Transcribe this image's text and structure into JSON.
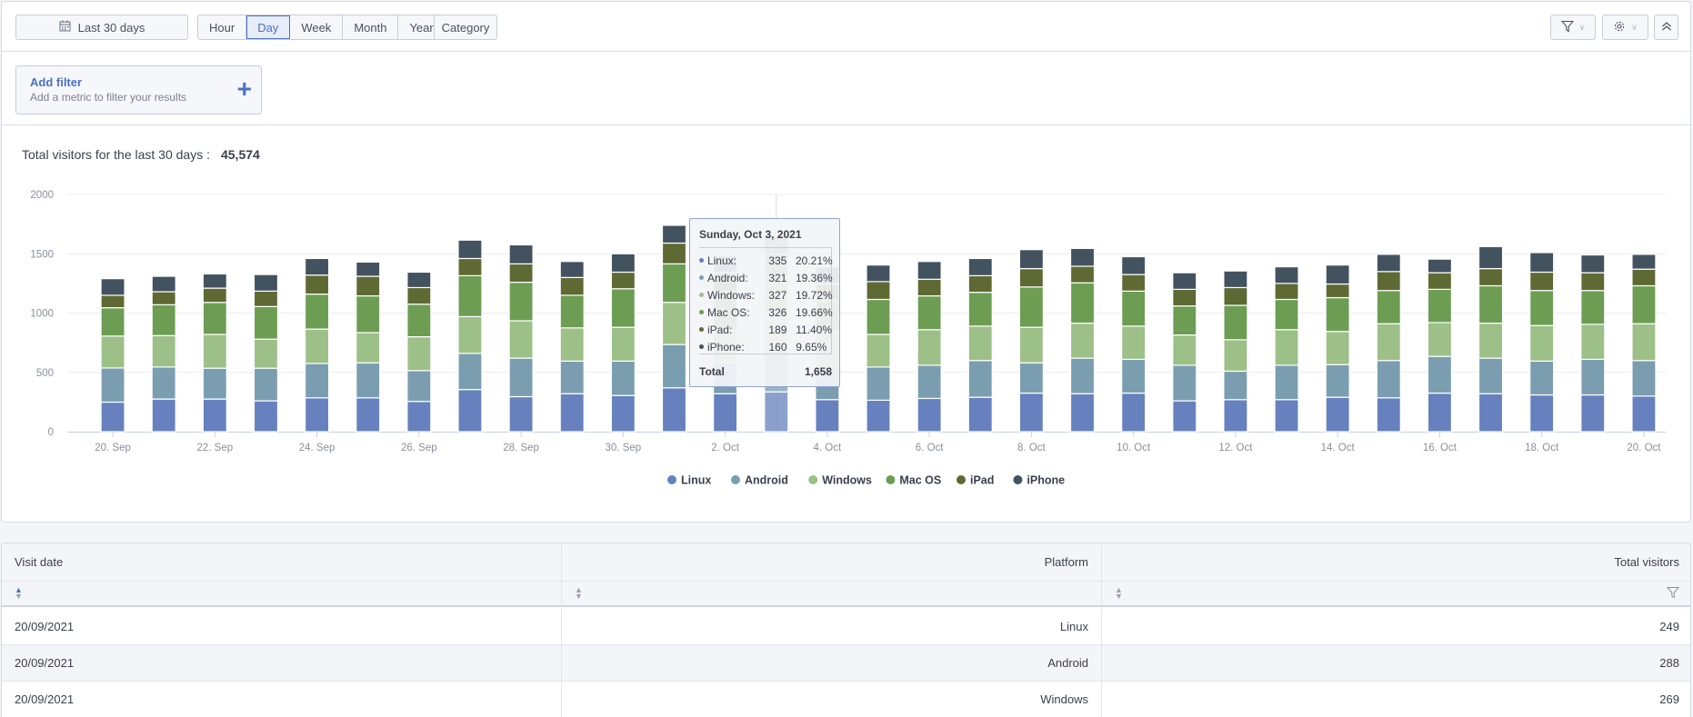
{
  "toolbar": {
    "date_range": "Last 30 days",
    "granularity": [
      "Hour",
      "Day",
      "Week",
      "Month",
      "Year"
    ],
    "granularity_selected": "Day",
    "category_label": "Category"
  },
  "filter": {
    "title": "Add filter",
    "subtitle": "Add a metric to filter your results",
    "plus": "+"
  },
  "summary": {
    "label": "Total visitors for the last 30 days :",
    "value": "45,574"
  },
  "chart_data": {
    "type": "bar",
    "stacked": true,
    "title": "",
    "xlabel": "",
    "ylabel": "",
    "ylim": [
      0,
      2000
    ],
    "yticks": [
      0,
      500,
      1000,
      1500,
      2000
    ],
    "grid": true,
    "legend_position": "bottom-center",
    "categories": [
      "20 Sep",
      "21 Sep",
      "22 Sep",
      "23 Sep",
      "24 Sep",
      "25 Sep",
      "26 Sep",
      "27 Sep",
      "28 Sep",
      "29 Sep",
      "30 Sep",
      "1 Oct",
      "2 Oct",
      "3 Oct",
      "4 Oct",
      "5 Oct",
      "6 Oct",
      "7 Oct",
      "8 Oct",
      "9 Oct",
      "10 Oct",
      "11 Oct",
      "12 Oct",
      "13 Oct",
      "14 Oct",
      "15 Oct",
      "16 Oct",
      "17 Oct",
      "18 Oct",
      "19 Oct",
      "20 Oct"
    ],
    "xtick_labels": [
      "20. Sep",
      "22. Sep",
      "24. Sep",
      "26. Sep",
      "28. Sep",
      "30. Sep",
      "2. Oct",
      "4. Oct",
      "6. Oct",
      "8. Oct",
      "10. Oct",
      "12. Oct",
      "14. Oct",
      "16. Oct",
      "18. Oct",
      "20. Oct"
    ],
    "series": [
      {
        "name": "Linux",
        "color": "#6681bd",
        "values": [
          249,
          275,
          275,
          260,
          285,
          285,
          255,
          355,
          295,
          320,
          305,
          370,
          320,
          335,
          270,
          265,
          280,
          290,
          325,
          320,
          325,
          260,
          270,
          270,
          290,
          285,
          325,
          320,
          310,
          310,
          300
        ]
      },
      {
        "name": "Android",
        "color": "#7a9eb0",
        "values": [
          288,
          270,
          260,
          275,
          290,
          295,
          260,
          305,
          325,
          275,
          290,
          365,
          265,
          321,
          270,
          280,
          280,
          310,
          255,
          300,
          285,
          300,
          240,
          290,
          275,
          315,
          310,
          300,
          285,
          300,
          300
        ]
      },
      {
        "name": "Windows",
        "color": "#9dbf88",
        "values": [
          269,
          265,
          285,
          245,
          290,
          255,
          285,
          310,
          315,
          280,
          285,
          355,
          270,
          327,
          300,
          275,
          300,
          290,
          300,
          295,
          280,
          255,
          265,
          300,
          280,
          310,
          285,
          295,
          300,
          295,
          310
        ]
      },
      {
        "name": "Mac OS",
        "color": "#6c9d53",
        "values": [
          239,
          260,
          270,
          275,
          295,
          310,
          275,
          345,
          325,
          275,
          325,
          325,
          325,
          326,
          265,
          295,
          285,
          285,
          340,
          340,
          295,
          245,
          290,
          255,
          285,
          280,
          280,
          315,
          295,
          285,
          320
        ]
      },
      {
        "name": "iPad",
        "color": "#5e6934",
        "values": [
          105,
          110,
          120,
          130,
          160,
          165,
          140,
          145,
          155,
          150,
          140,
          175,
          160,
          189,
          140,
          150,
          140,
          140,
          155,
          140,
          140,
          140,
          150,
          135,
          115,
          160,
          140,
          145,
          155,
          150,
          140
        ]
      },
      {
        "name": "iPhone",
        "color": "#43525f",
        "values": [
          140,
          130,
          120,
          140,
          140,
          120,
          130,
          155,
          160,
          135,
          155,
          150,
          140,
          160,
          145,
          140,
          150,
          145,
          160,
          150,
          150,
          140,
          140,
          140,
          160,
          145,
          115,
          185,
          165,
          150,
          125
        ]
      }
    ],
    "highlighted_category": "3 Oct"
  },
  "tooltip": {
    "title": "Sunday, Oct 3, 2021",
    "rows": [
      {
        "label": "Linux:",
        "value": "335",
        "pct": "20.21%",
        "color": "#6681bd"
      },
      {
        "label": "Android:",
        "value": "321",
        "pct": "19.36%",
        "color": "#7a9eb0"
      },
      {
        "label": "Windows:",
        "value": "327",
        "pct": "19.72%",
        "color": "#9dbf88"
      },
      {
        "label": "Mac OS:",
        "value": "326",
        "pct": "19.66%",
        "color": "#6c9d53"
      },
      {
        "label": "iPad:",
        "value": "189",
        "pct": "11.40%",
        "color": "#5e6934"
      },
      {
        "label": "iPhone:",
        "value": "160",
        "pct": "9.65%",
        "color": "#43525f"
      }
    ],
    "total_label": "Total",
    "total_value": "1,658"
  },
  "table": {
    "columns": [
      "Visit date",
      "Platform",
      "Total visitors"
    ],
    "rows": [
      [
        "20/09/2021",
        "Linux",
        "249"
      ],
      [
        "20/09/2021",
        "Android",
        "288"
      ],
      [
        "20/09/2021",
        "Windows",
        "269"
      ]
    ]
  }
}
